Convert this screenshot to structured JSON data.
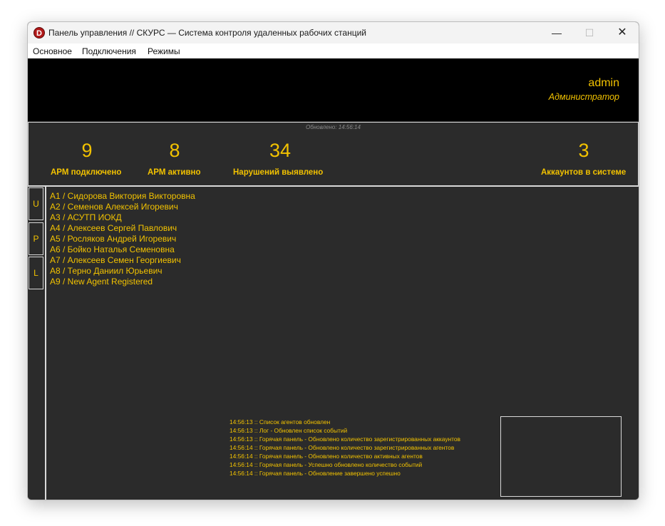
{
  "window": {
    "title": "Панель управления // СКУРС — Система контроля удаленных рабочих станций",
    "icon_letter": "D",
    "min_glyph": "—",
    "max_glyph": "☐",
    "close_glyph": "✕"
  },
  "menu": [
    "Основное",
    "Подключения",
    "Режимы"
  ],
  "header": {
    "user": "admin",
    "role": "Администратор"
  },
  "stats": {
    "updated": "Обновлено: 14:56:14",
    "items": [
      {
        "value": "9",
        "label": "АРМ подключено"
      },
      {
        "value": "8",
        "label": "АРМ активно"
      },
      {
        "value": "34",
        "label": "Нарушений выявлено"
      },
      {
        "value": "3",
        "label": "Аккаунтов в системе"
      }
    ]
  },
  "tabs": [
    "U",
    "P",
    "L"
  ],
  "agents": [
    "A1 / Сидорова Виктория Викторовна",
    "A2 / Семенов Алексей Игоревич",
    "A3 / АСУТП ИОКД",
    "A4 / Алексеев Сергей Павлович",
    "A5 / Росляков Андрей Игоревич",
    "A6 / Бойко Наталья Семеновна",
    "A7 / Алексеев Семен Георгиевич",
    "A8 / Терно Даниил Юрьевич",
    "A9 / New Agent Registered"
  ],
  "log": [
    "14:56:13 :: Список агентов обновлен",
    "14:56:13 :: Лог - Обновлен список событий",
    "14:56:13 :: Горячая панель - Обновлено количество зарегистрированных аккаунтов",
    "14:56:14 :: Горячая панель - Обновлено количество зарегистрированных агентов",
    "14:56:14 :: Горячая панель - Обновлено количество активных агентов",
    "14:56:14 :: Горячая панель - Успешно обновлено количество событий",
    "14:56:14 :: Горячая панель - Обновление завершено успешно"
  ],
  "colors": {
    "accent": "#f2c200",
    "background": "#2b2b2b",
    "header": "#000000"
  }
}
